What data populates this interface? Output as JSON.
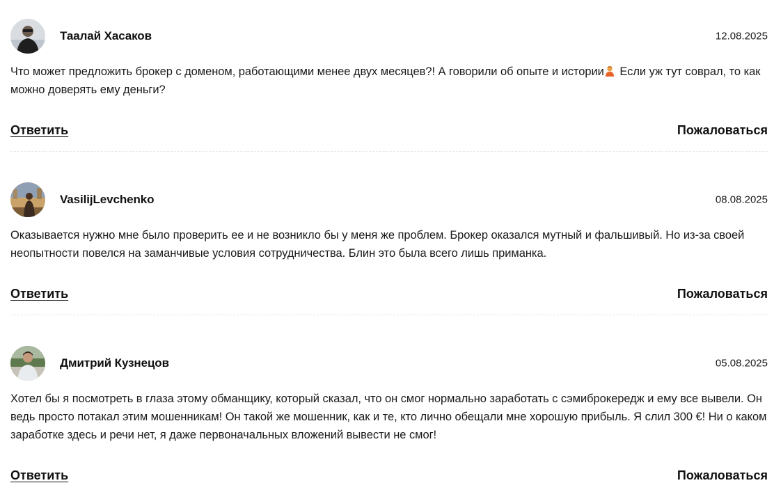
{
  "comments": [
    {
      "author": "Таалай Хасаков",
      "date": "12.08.2025",
      "text_before_emoji": "Что может предложить брокер с доменом, работающими менее двух месяцев?! А говорили об опыте и истории",
      "emoji": "person-emoji",
      "text_after_emoji": " Если уж тут соврал, то как можно доверять ему деньги?",
      "reply_label": "Ответить",
      "report_label": "Пожаловаться"
    },
    {
      "author": "VasilijLevchenko",
      "date": "08.08.2025",
      "text": "Оказывается нужно мне было проверить ее и не возникло бы у меня же проблем. Брокер оказался мутный и фальшивый. Но из-за своей неопытности повелся на заманчивые условия сотрудничества. Блин это была всего лишь приманка.",
      "reply_label": "Ответить",
      "report_label": "Пожаловаться"
    },
    {
      "author": "Дмитрий Кузнецов",
      "date": "05.08.2025",
      "text": "Хотел бы я посмотреть в глаза этому обманщику, который сказал, что он смог нормально заработать с сэмиброкередж и ему все вывели. Он ведь просто потакал этим мошенникам! Он такой же мошенник, как и те, кто лично обещали мне хорошую прибыль. Я слил 300 €! Ни о каком заработке здесь и речи нет, я даже первоначальных вложений вывести не смог!",
      "reply_label": "Ответить",
      "report_label": "Пожаловаться"
    }
  ]
}
